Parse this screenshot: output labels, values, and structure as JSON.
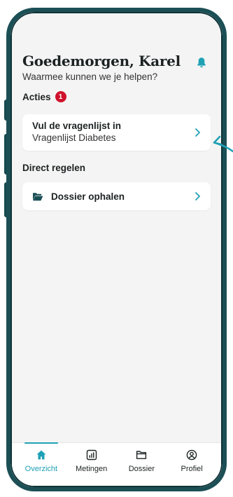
{
  "colors": {
    "accent": "#1fa1b5",
    "badge": "#d0112b",
    "frame": "#1b4f55",
    "text": "#1c2222"
  },
  "header": {
    "greeting": "Goedemorgen, Karel",
    "subtitle": "Waarmee kunnen we je helpen?",
    "notification_icon": "bell-icon"
  },
  "actions": {
    "title": "Acties",
    "badge_count": "1",
    "items": [
      {
        "title": "Vul de vragenlijst in",
        "subtitle": "Vragenlijst Diabetes",
        "icon": "chevron-right-icon"
      }
    ]
  },
  "direct": {
    "title": "Direct regelen",
    "items": [
      {
        "label": "Dossier ophalen",
        "icon": "folder-open-icon"
      }
    ]
  },
  "tabbar": {
    "tabs": [
      {
        "label": "Overzicht",
        "icon": "home-icon",
        "active": true
      },
      {
        "label": "Metingen",
        "icon": "chart-icon",
        "active": false
      },
      {
        "label": "Dossier",
        "icon": "folder-icon",
        "active": false
      },
      {
        "label": "Profiel",
        "icon": "user-circle-icon",
        "active": false
      }
    ]
  }
}
